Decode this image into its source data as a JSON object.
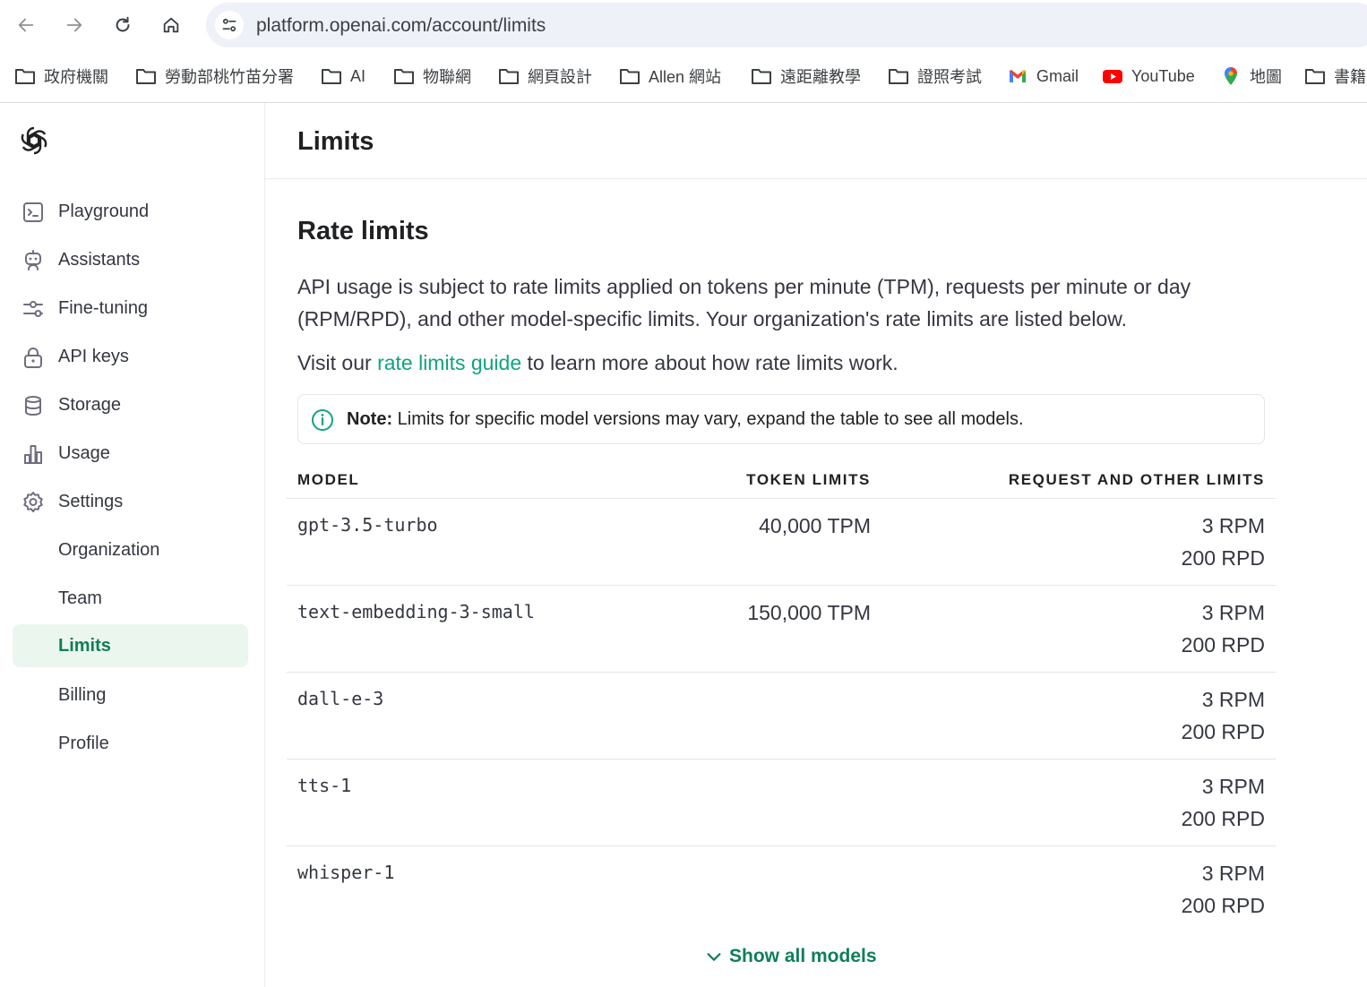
{
  "browser": {
    "url": "platform.openai.com/account/limits",
    "bookmarks": [
      {
        "label": "政府機關",
        "icon": "folder-icon"
      },
      {
        "label": "勞動部桃竹苗分署",
        "icon": "folder-icon"
      },
      {
        "label": "AI",
        "icon": "folder-icon"
      },
      {
        "label": "物聯網",
        "icon": "folder-icon"
      },
      {
        "label": "網頁設計",
        "icon": "folder-icon"
      },
      {
        "label": "Allen 網站",
        "icon": "folder-icon"
      },
      {
        "label": "遠距離教學",
        "icon": "folder-icon"
      },
      {
        "label": "證照考試",
        "icon": "folder-icon"
      },
      {
        "label": "Gmail",
        "icon": "gmail-icon"
      },
      {
        "label": "YouTube",
        "icon": "youtube-icon"
      },
      {
        "label": "地圖",
        "icon": "maps-icon"
      },
      {
        "label": "書籍",
        "icon": "folder-icon"
      }
    ]
  },
  "sidebar": {
    "items": [
      {
        "label": "Playground",
        "icon": "playground-icon"
      },
      {
        "label": "Assistants",
        "icon": "assistant-icon"
      },
      {
        "label": "Fine-tuning",
        "icon": "fine-tuning-icon"
      },
      {
        "label": "API keys",
        "icon": "lock-icon"
      },
      {
        "label": "Storage",
        "icon": "database-icon"
      },
      {
        "label": "Usage",
        "icon": "bar-chart-icon"
      },
      {
        "label": "Settings",
        "icon": "gear-icon"
      },
      {
        "label": "Organization"
      },
      {
        "label": "Team"
      },
      {
        "label": "Limits",
        "active": true
      },
      {
        "label": "Billing"
      },
      {
        "label": "Profile"
      }
    ]
  },
  "main": {
    "title": "Limits",
    "section_title": "Rate limits",
    "description": "API usage is subject to rate limits applied on tokens per minute (TPM), requests per minute or day (RPM/RPD), and other model-specific limits. Your organization's rate limits are listed below.",
    "visit_prefix": "Visit our",
    "visit_link": "rate limits guide",
    "visit_suffix": "to learn more about how rate limits work.",
    "note_label": "Note:",
    "note_text": "Limits for specific model versions may vary, expand the table to see all models.",
    "table": {
      "headers": {
        "model": "MODEL",
        "token": "TOKEN LIMITS",
        "request": "REQUEST AND OTHER LIMITS"
      },
      "rows": [
        {
          "model": "gpt-3.5-turbo",
          "token": "40,000 TPM",
          "rpm": "3 RPM",
          "rpd": "200 RPD"
        },
        {
          "model": "text-embedding-3-small",
          "token": "150,000 TPM",
          "rpm": "3 RPM",
          "rpd": "200 RPD"
        },
        {
          "model": "dall-e-3",
          "token": "",
          "rpm": "3 RPM",
          "rpd": "200 RPD"
        },
        {
          "model": "tts-1",
          "token": "",
          "rpm": "3 RPM",
          "rpd": "200 RPD"
        },
        {
          "model": "whisper-1",
          "token": "",
          "rpm": "3 RPM",
          "rpd": "200 RPD"
        }
      ]
    },
    "show_all": "Show all models",
    "colors": {
      "accent": "#10a37f",
      "active_bg": "#ebf6ee",
      "active_text": "#0f7e5a"
    }
  }
}
